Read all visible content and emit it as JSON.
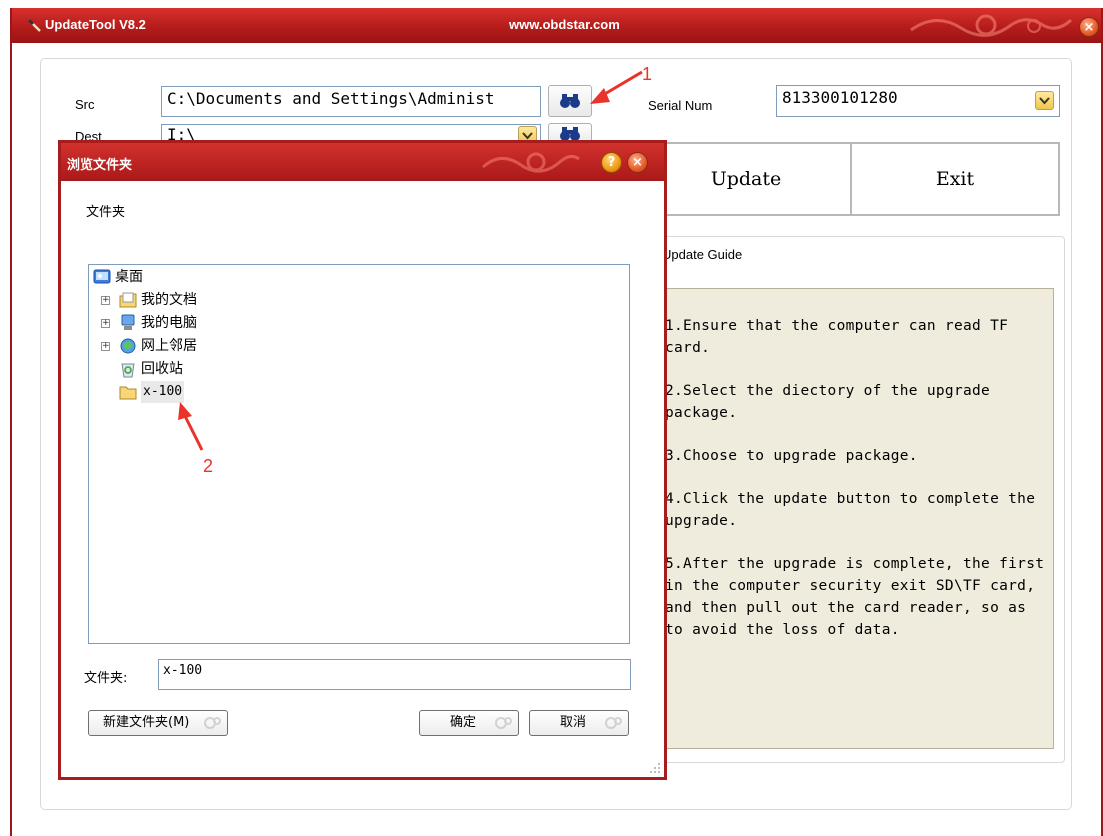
{
  "window": {
    "title": "UpdateTool V8.2",
    "url": "www.obdstar.com",
    "close_glyph": "×"
  },
  "form": {
    "src_label": "Src",
    "src_value": "C:\\Documents and Settings\\Administ",
    "dest_label": "Dest",
    "dest_value": "I:\\",
    "serial_label": "Serial Num",
    "serial_value": "813300101280",
    "update_label": "Update",
    "exit_label": "Exit"
  },
  "guide": {
    "title": "Update Guide",
    "steps": [
      "1.Ensure that the computer can read TF card.",
      "2.Select the diectory of the upgrade package.",
      "3.Choose to upgrade package.",
      "4.Click the update button to complete the upgrade.",
      "5.After the upgrade is complete, the first in the computer security exit SD\\TF card, and then pull out the card reader, so as to avoid the loss of data."
    ]
  },
  "dialog": {
    "title": "浏览文件夹",
    "help_glyph": "?",
    "close_glyph": "×",
    "instruction": "文件夹",
    "tree": [
      {
        "label": "桌面",
        "icon": "desktop-icon"
      },
      {
        "label": "我的文档",
        "icon": "my-documents-icon",
        "expander": "+"
      },
      {
        "label": "我的电脑",
        "icon": "my-computer-icon",
        "expander": "+"
      },
      {
        "label": "网上邻居",
        "icon": "network-icon",
        "expander": "+"
      },
      {
        "label": "回收站",
        "icon": "recycle-bin-icon"
      },
      {
        "label": "x-100",
        "icon": "folder-icon",
        "selected": true
      }
    ],
    "folder_label": "文件夹:",
    "folder_value": "x-100",
    "new_folder_label": "新建文件夹(M)",
    "ok_label": "确定",
    "cancel_label": "取消"
  },
  "annotations": [
    "1",
    "2"
  ],
  "colors": {
    "titlebar": "#b51c1c",
    "guide_bg": "#f0ecdd",
    "annotation": "#e8342a",
    "combo_arrow": "#f2c64a"
  }
}
